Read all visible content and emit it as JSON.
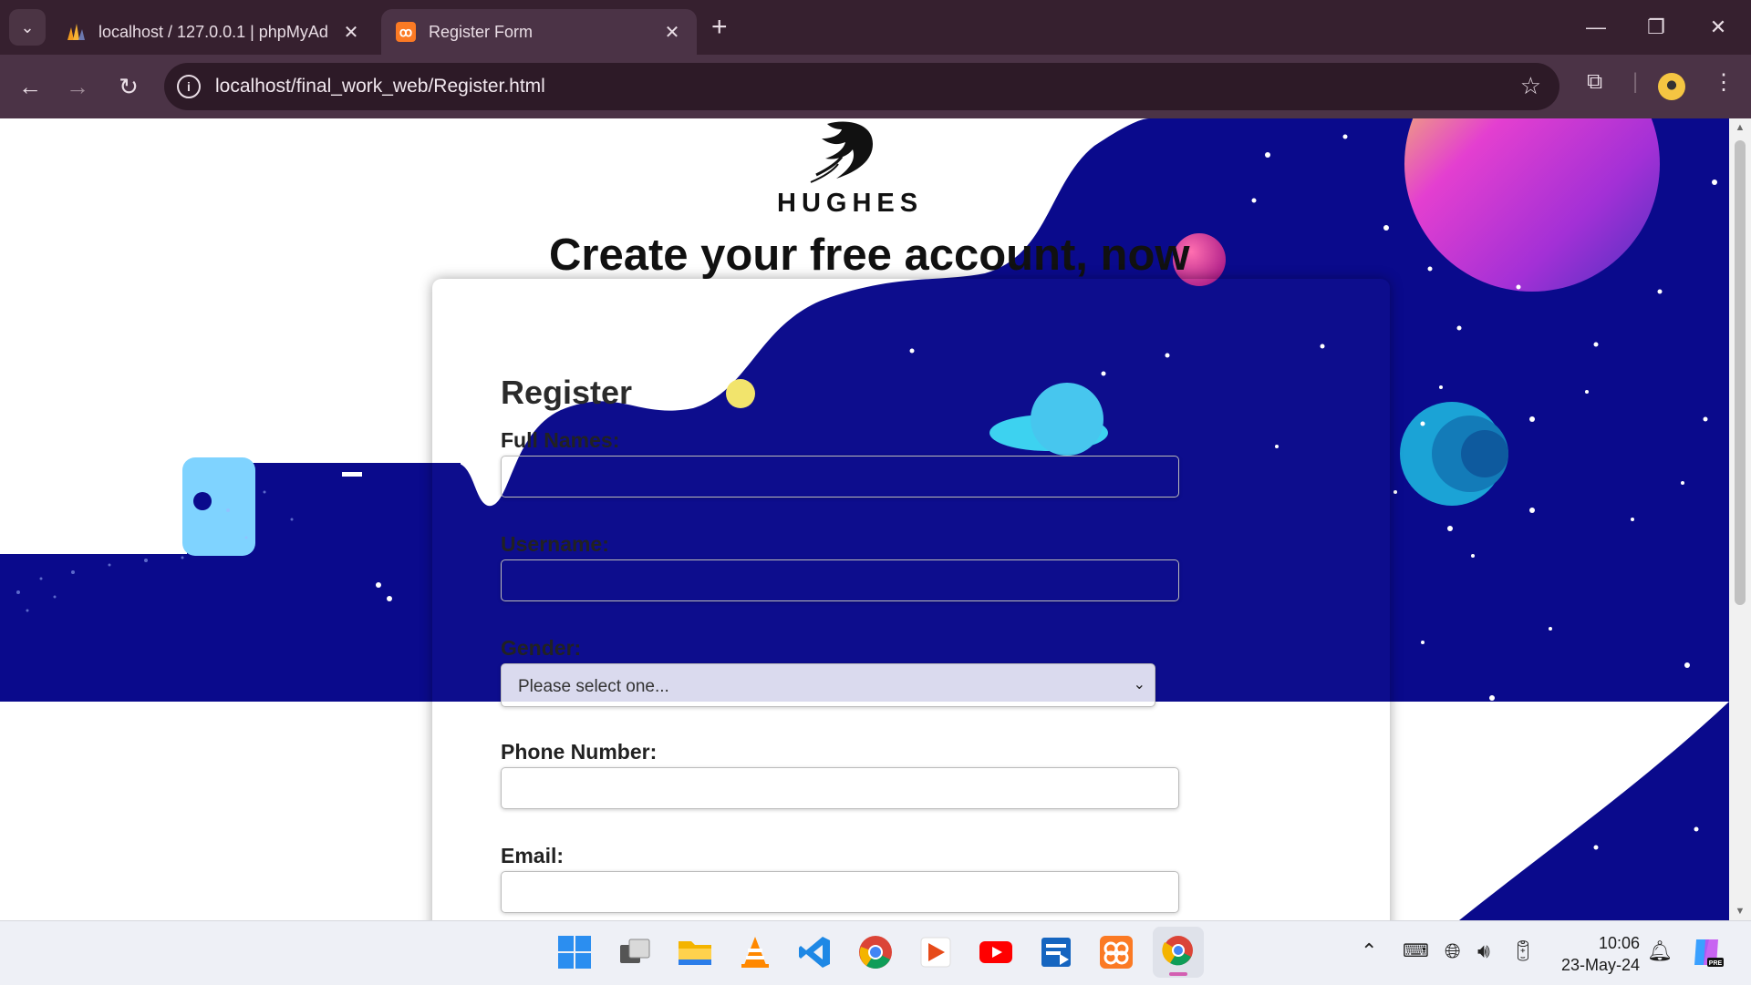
{
  "browser": {
    "tabs": [
      {
        "title": "localhost / 127.0.0.1 | phpMyAd",
        "icon": "phpmyadmin-icon",
        "active": false
      },
      {
        "title": "Register Form",
        "icon": "xampp-icon",
        "active": true
      }
    ],
    "url": "localhost/final_work_web/Register.html",
    "accent": "#36202f"
  },
  "page": {
    "logo_text": "HUGHES",
    "headline": "Create your free account, now",
    "form": {
      "title": "Register",
      "fields": [
        {
          "label": "Full Names:",
          "value": ""
        },
        {
          "label": "Username:",
          "value": ""
        },
        {
          "label": "Gender:",
          "selected": "Please select one..."
        },
        {
          "label": "Phone Number:",
          "value": ""
        },
        {
          "label": "Email:",
          "value": ""
        }
      ]
    },
    "colors": {
      "space": "#0a0a8c",
      "text": "#111111"
    }
  },
  "taskbar": {
    "time": "10:06",
    "date": "23-May-24",
    "apps": [
      "windows-start-icon",
      "task-view-icon",
      "file-explorer-icon",
      "vlc-icon",
      "vscode-icon",
      "chrome-icon",
      "media-player-icon",
      "youtube-icon",
      "remote-app-icon",
      "xampp-icon",
      "chrome-profile-icon"
    ]
  }
}
